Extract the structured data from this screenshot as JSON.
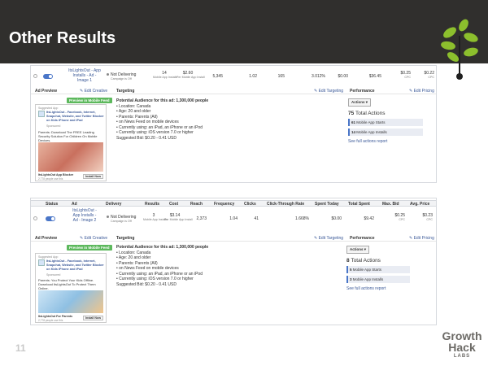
{
  "slide": {
    "title": "Other Results",
    "number": "11",
    "brand": {
      "line1": "Growth",
      "line2": "Hack",
      "line3": "LABS"
    },
    "colors": {
      "header_bg": "#302f2d",
      "leaf_green": "#8cbf2d",
      "accent_blue": "#4a76c8",
      "preview_green": "#5cb85c"
    }
  },
  "shot1": {
    "row": {
      "ad_name": "ItsLightsOut - App Installs - Ad - Image 1",
      "delivery": "Not Delivering",
      "delivery_sub": "Campaign is Off",
      "results": "14",
      "results_sub": "Mobile App Installs",
      "cost": "$2.60",
      "cost_sub": "Per Mobile App Install",
      "reach": "5,345",
      "frequency": "1.02",
      "clicks": "165",
      "ctr": "3.012%",
      "spent_today": "$0.00",
      "total_spent": "$36.45",
      "max_bid": "$0.25",
      "max_bid_sub": "CPC",
      "avg_price": "$0.22",
      "avg_price_sub": "CPC"
    },
    "sections": {
      "ad_preview": "Ad Preview",
      "edit_creative": "✎ Edit Creative",
      "targeting": "Targeting",
      "edit_targeting": "✎ Edit Targeting",
      "performance": "Performance",
      "edit_pricing": "✎ Edit Pricing"
    },
    "preview_button": "Preview in Mobile Feed",
    "ad": {
      "suggested": "Suggested App",
      "header": "ItsLightsOut - Facebook, Internet, Snapchat, Website, and Twitter Blocker on Kids iPhone and iPad",
      "sponsored": "Sponsored",
      "body": "Parents: Download The FREE Leading Security Solution For Children On Mobile Devices.",
      "app_name": "ItsLightsOut App Blocker",
      "app_sub": "2,778 people use this",
      "install": "Install Now"
    },
    "targeting": {
      "title": "Potential Audience for this ad: 1,300,000 people",
      "items": [
        "Location: Canada",
        "Age: 20 and older",
        "Parents: Parents (All)",
        "on News Feed on mobile devices",
        "Currently using: an iPad, an iPhone or an iPod",
        "Currently using: iOS version 7.0 or higher"
      ],
      "suggested_bid": "Suggested Bid: $0.20 - 0.41 USD"
    },
    "performance": {
      "actions_button": "Actions ▾",
      "total_count": "75",
      "total_label": "Total Actions",
      "metrics": [
        {
          "count": "61",
          "label": "Mobile App Starts"
        },
        {
          "count": "14",
          "label": "Mobile App Installs"
        }
      ],
      "see_full": "See full actions report"
    }
  },
  "shot2": {
    "headers": [
      "Status",
      "Ad",
      "Delivery",
      "Results",
      "Cost",
      "Reach",
      "Frequency",
      "Clicks",
      "Click-Through Rate",
      "Spent Today",
      "Total Spent",
      "Max. Bid",
      "Avg. Price"
    ],
    "row": {
      "ad_name": "ItsLightsOut - App Installs - Ad - Image 2",
      "delivery": "Not Delivering",
      "delivery_sub": "Campaign is Off",
      "results": "3",
      "results_sub": "Mobile App Installs",
      "cost": "$3.14",
      "cost_sub": "Per Mobile App Install",
      "reach": "2,373",
      "frequency": "1.04",
      "clicks": "41",
      "ctr": "1.668%",
      "spent_today": "$0.00",
      "total_spent": "$9.42",
      "max_bid": "$0.25",
      "max_bid_sub": "CPC",
      "avg_price": "$0.23",
      "avg_price_sub": "CPC"
    },
    "sections": {
      "ad_preview": "Ad Preview",
      "edit_creative": "✎ Edit Creative",
      "targeting": "Targeting",
      "edit_targeting": "✎ Edit Targeting",
      "performance": "Performance",
      "edit_pricing": "✎ Edit Pricing"
    },
    "preview_button": "Preview in Mobile Feed",
    "ad": {
      "suggested": "Suggested App",
      "header": "ItsLightsOut - Facebook, Internet, Snapchat, Website, and Twitter Blocker on Kids iPhone and iPad",
      "sponsored": "Sponsored",
      "body": "Parents: You Protect Your Kids Offline. Download ItsLightsOut To Protect Them Online.",
      "app_name": "ItsLightsOut For Parents",
      "app_sub": "2,778 people use this",
      "install": "Install Now"
    },
    "targeting": {
      "title": "Potential Audience for this ad: 1,300,000 people",
      "items": [
        "Location: Canada",
        "Age: 20 and older",
        "Parents: Parents (All)",
        "on News Feed on mobile devices",
        "Currently using: an iPad, an iPhone or an iPod",
        "Currently using: iOS version 7.0 or higher"
      ],
      "suggested_bid": "Suggested Bid: $0.20 - 0.41 USD"
    },
    "performance": {
      "actions_button": "Actions ▾",
      "total_count": "8",
      "total_label": "Total Actions",
      "metrics": [
        {
          "count": "5",
          "label": "Mobile App Starts"
        },
        {
          "count": "3",
          "label": "Mobile App Installs"
        }
      ],
      "see_full": "See full actions report"
    }
  }
}
